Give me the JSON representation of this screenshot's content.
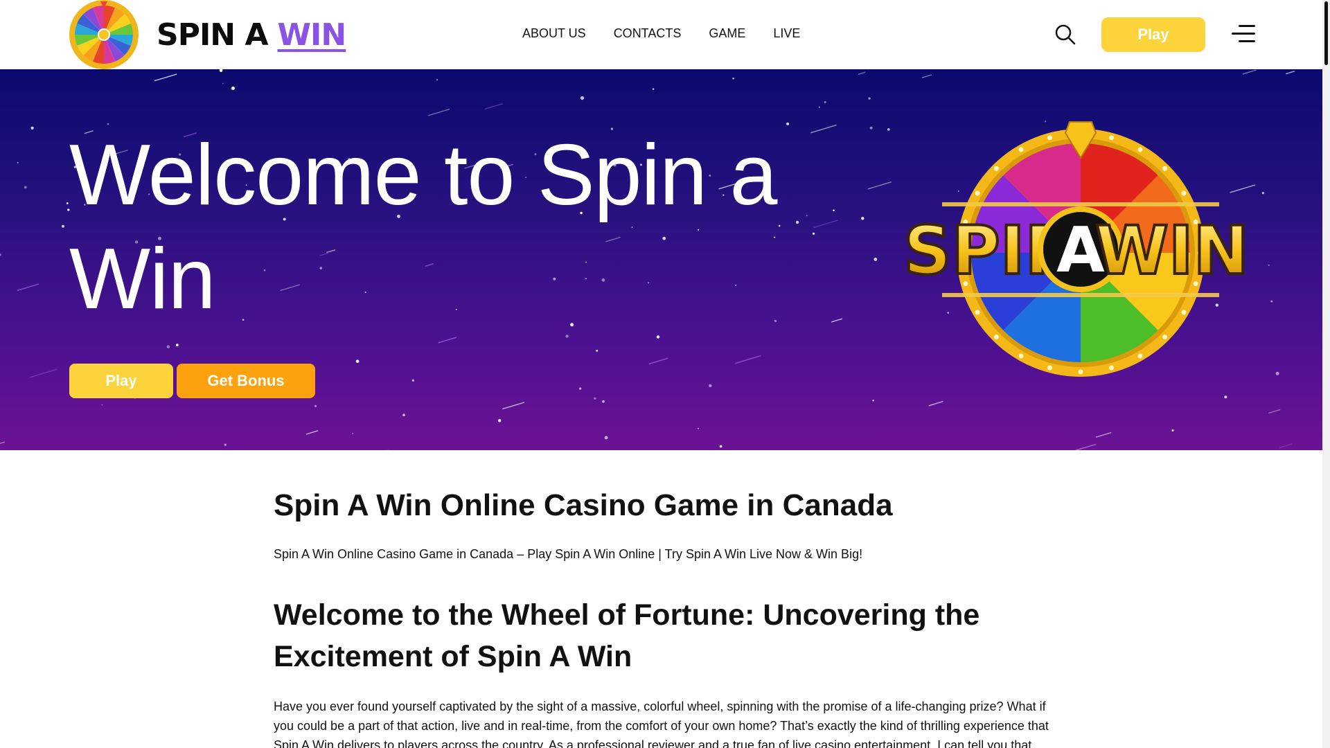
{
  "header": {
    "logo": {
      "word1": "SPIN A",
      "word2": "WIN"
    },
    "nav": [
      "ABOUT US",
      "CONTACTS",
      "GAME",
      "LIVE"
    ],
    "play_label": "Play",
    "icons": {
      "search": "search-icon",
      "menu": "hamburger-menu-icon"
    }
  },
  "hero": {
    "title": "Welcome to Spin a Win",
    "play_label": "Play",
    "bonus_label": "Get Bonus",
    "logo_text": {
      "left": "SPIN",
      "center": "A",
      "right": "WIN"
    }
  },
  "content": {
    "h1": "Spin A Win Online Casino Game in Canada",
    "subtitle": "Spin A Win Online Casino Game in Canada – Play Spin A Win Online | Try Spin A Win Live Now & Win Big!",
    "h2": "Welcome to the Wheel of Fortune: Uncovering the Excitement of Spin A Win",
    "paragraph": "Have you ever found yourself captivated by the sight of a massive, colorful wheel, spinning with the promise of a life-changing prize? What if you could be a part of that action, live and in real-time, from the comfort of your own home? That’s exactly the kind of thrilling experience that Spin A Win delivers to players across the country. As a professional reviewer and a true fan of live casino entertainment, I can tell you that"
  },
  "colors": {
    "accent_yellow": "#fdd33c",
    "accent_orange": "#fda10f",
    "logo_purple": "#8a53e6",
    "hero_top": "#0a0a6e",
    "hero_bottom": "#6b1294"
  }
}
